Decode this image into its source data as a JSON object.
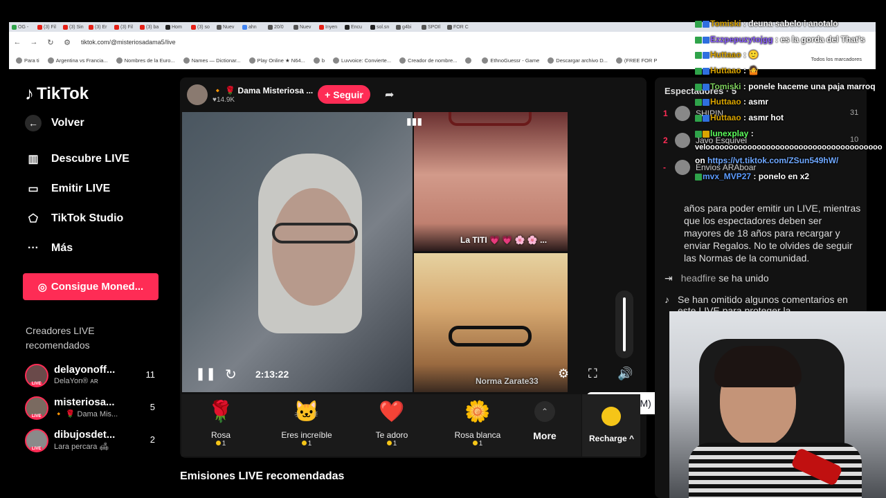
{
  "browser": {
    "tabs": [
      "OG -",
      "(3) Fil",
      "(3) Sin",
      "(3) Er",
      "(3) Fil",
      "(3) ba",
      "Hom",
      "(3) so",
      "Nuev",
      "ahn",
      "20/0",
      "Nuev",
      "Inyen",
      "Encu",
      "sol.sn",
      "g4bi",
      "SPOIl",
      "FOR C"
    ],
    "url": "tiktok.com/@misteriosadama5/live",
    "bookmarks": [
      "Para ti",
      "Argentina vs Francia...",
      "Nombres de la Euro...",
      "Names — Dictionar...",
      "Play Online ★ N64...",
      "b",
      "Luvvoice: Convierte...",
      "Creador de nombre...",
      "",
      "EthnoGuessr - Game",
      "Descargar archivo D...",
      "(FREE FOR P"
    ],
    "all_bookmarks": "Todos los marcadores"
  },
  "sidebar": {
    "logo": "TikTok",
    "items": [
      {
        "label": "Volver",
        "icon": "arrow-left-icon"
      },
      {
        "label": "Descubre LIVE",
        "icon": "live-calendar-icon"
      },
      {
        "label": "Emitir LIVE",
        "icon": "camera-icon"
      },
      {
        "label": "TikTok Studio",
        "icon": "studio-icon"
      },
      {
        "label": "Más",
        "icon": "more-dots-icon"
      }
    ],
    "coins_button": "Consigue Moned...",
    "creators_title": "Creadores LIVE recomendados",
    "creators": [
      {
        "name": "delayonoff...",
        "sub": "DelaYon® ᴀʀ",
        "count": "11"
      },
      {
        "name": "misteriosa...",
        "sub": "🔸 🌹 Dama Mis...",
        "count": "5"
      },
      {
        "name": "dibujosdet...",
        "sub": "Lara percara 🛋",
        "count": "2"
      }
    ],
    "live_badge": "LIVE"
  },
  "player": {
    "host_name": "🔸 🌹 Dama Misteriosa ...",
    "likes": "♥14.9K",
    "follow": "+ Seguir",
    "time": "2:13:22",
    "label_top": "La TITI 💗 💗 🌸 🌸 ...",
    "label_bot": "Norma Zarate33",
    "tooltip": "Silenciar (M)",
    "volume": 1.0
  },
  "gifts": [
    {
      "icon": "🌹",
      "name": "Rosa",
      "price": "1"
    },
    {
      "icon": "🐱",
      "name": "Eres increíble",
      "price": "1"
    },
    {
      "icon": "❤️",
      "name": "Te adoro",
      "price": "1"
    },
    {
      "icon": "🌼",
      "name": "Rosa blanca",
      "price": "1"
    }
  ],
  "more_label": "More",
  "recharge_label": "Recharge ^",
  "emisiones_title": "Emisiones LIVE recomendadas",
  "chat": {
    "spectators_title": "Espectadores · 5",
    "ranking": [
      {
        "rank": "1",
        "name": "SHIPIN",
        "count": "31"
      },
      {
        "rank": "2",
        "name": "Javo Esquivel",
        "count": "10"
      },
      {
        "rank": "-",
        "name": "Envios ARAboar",
        "count": ""
      }
    ],
    "rules": "años para poder emitir un LIVE, mientras que los espectadores deben ser mayores de 18 años para recargar y enviar Regalos. No te olvides de seguir las Normas de la comunidad.",
    "joined_user": "headfire",
    "joined_text": "se ha unido",
    "omitted": "Se han omitido algunos comentarios en este LIVE para proteger la"
  },
  "overlay_chat": [
    {
      "user": "Tomiski",
      "msg": "deuna sabelo i anotalo",
      "color": "#d9a400"
    },
    {
      "user": "Ezzpepuzytojgg",
      "msg": "es la gorda del That's",
      "color": "#8a5cff"
    },
    {
      "user": "Huttaao",
      "msg": "🙂",
      "color": "#d9a400"
    },
    {
      "user": "Huttaao",
      "msg": "🤷",
      "color": "#d9a400"
    },
    {
      "user": "Tomiski",
      "msg": "ponele haceme una paja marroq",
      "color": "#7ccf5a"
    },
    {
      "user": "Huttaao",
      "msg": "asmr",
      "color": "#d9a400"
    },
    {
      "user": "Huttaao",
      "msg": "asmr hot",
      "color": "#d9a400"
    },
    {
      "user": "lunexplay",
      "msg": "veloooooooooooooooooooooooooooooooooooooo",
      "color": "#5cff5c"
    },
    {
      "user": "on",
      "msg": "https://vt.tiktok.com/ZSun549hW/",
      "color": "#ffffff"
    },
    {
      "user": "mvx_MVP27",
      "msg": "ponelo en x2",
      "color": "#5c9cff"
    }
  ],
  "colors": {
    "tiktok_red": "#fe2c55",
    "bg": "#000000",
    "panel": "#121212"
  }
}
